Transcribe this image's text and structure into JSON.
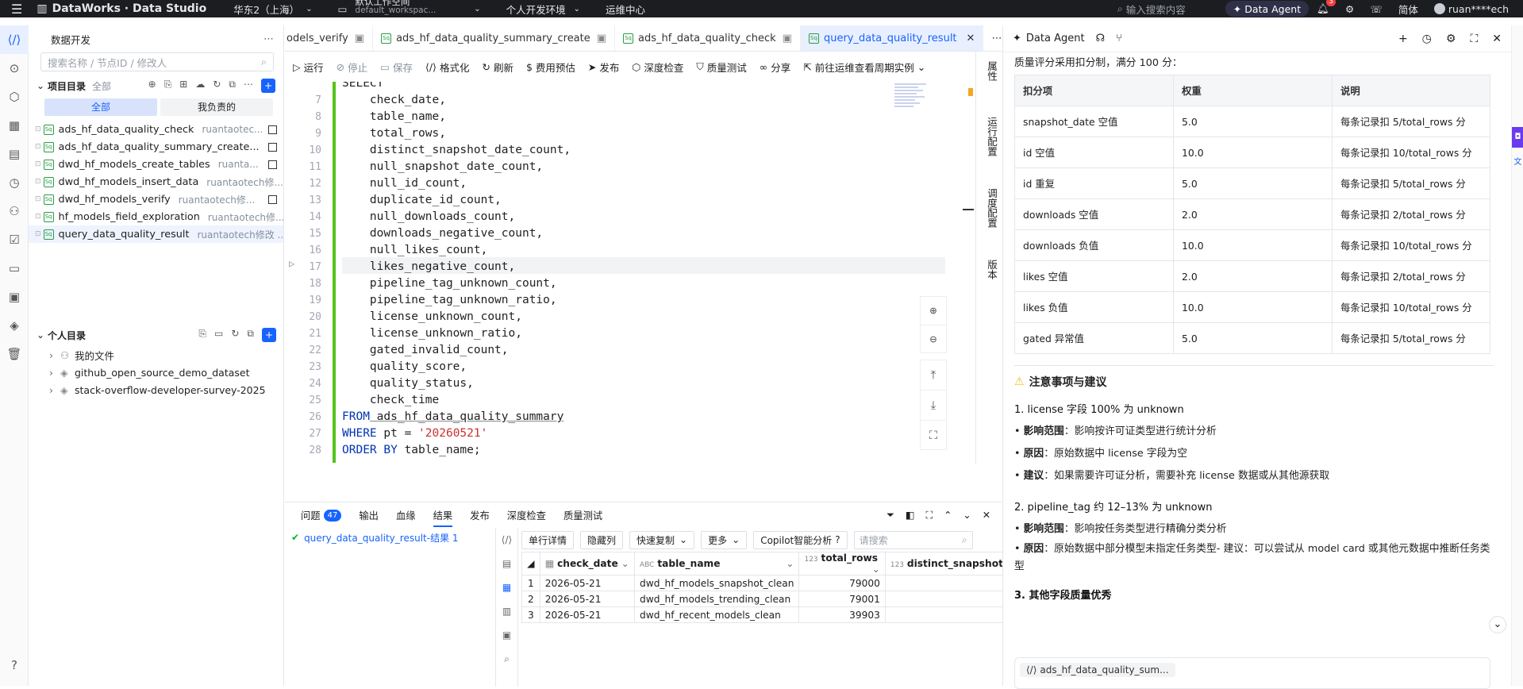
{
  "topbar": {
    "brand": "DataWorks · Data Studio",
    "region": "华东2（上海）",
    "workspace_title": "默认工作空间",
    "workspace_sub": "default_workspac...",
    "env": "个人开发环境",
    "ops": "运维中心",
    "search_placeholder": "输入搜索内容",
    "agent_button": "Data Agent",
    "notif_count": "3",
    "lang": "简体",
    "user": "ruan****ech"
  },
  "sidebar": {
    "title": "数据开发",
    "search_placeholder": "搜索名称 / 节点ID / 修改人",
    "project_dir": "项目目录",
    "project_scope": "全部",
    "filter_all": "全部",
    "filter_mine": "我负责的",
    "files": [
      {
        "name": "ads_hf_data_quality_check",
        "owner": "ruantaotec..."
      },
      {
        "name": "ads_hf_data_quality_summary_create...",
        "owner": ""
      },
      {
        "name": "dwd_hf_models_create_tables",
        "owner": "ruanta..."
      },
      {
        "name": "dwd_hf_models_insert_data",
        "owner": "ruantaotech修..."
      },
      {
        "name": "dwd_hf_models_verify",
        "owner": "ruantaotech修..."
      },
      {
        "name": "hf_models_field_exploration",
        "owner": "ruantaotech修..."
      },
      {
        "name": "query_data_quality_result",
        "owner": "ruantaotech修改 ..."
      }
    ],
    "personal_dir": "个人目录",
    "personal_items": [
      "我的文件",
      "github_open_source_demo_dataset",
      "stack-overflow-developer-survey-2025"
    ]
  },
  "tabs": [
    "odels_verify",
    "ads_hf_data_quality_summary_create",
    "ads_hf_data_quality_check",
    "query_data_quality_result"
  ],
  "toolbar": {
    "run": "运行",
    "stop": "停止",
    "save": "保存",
    "format": "格式化",
    "refresh": "刷新",
    "cost": "费用预估",
    "publish": "发布",
    "deep_check": "深度检查",
    "quality_test": "质量测试",
    "share": "分享",
    "goto_ops": "前往运维查看周期实例"
  },
  "code": {
    "first_line": "SELECT",
    "lines": [
      {
        "n": "7",
        "t": "    check_date,"
      },
      {
        "n": "8",
        "t": "    table_name,"
      },
      {
        "n": "9",
        "t": "    total_rows,"
      },
      {
        "n": "10",
        "t": "    distinct_snapshot_date_count,"
      },
      {
        "n": "11",
        "t": "    null_snapshot_date_count,"
      },
      {
        "n": "12",
        "t": "    null_id_count,"
      },
      {
        "n": "13",
        "t": "    duplicate_id_count,"
      },
      {
        "n": "14",
        "t": "    null_downloads_count,"
      },
      {
        "n": "15",
        "t": "    downloads_negative_count,"
      },
      {
        "n": "16",
        "t": "    null_likes_count,"
      },
      {
        "n": "17",
        "t": "    likes_negative_count,"
      },
      {
        "n": "18",
        "t": "    pipeline_tag_unknown_count,"
      },
      {
        "n": "19",
        "t": "    pipeline_tag_unknown_ratio,"
      },
      {
        "n": "20",
        "t": "    license_unknown_count,"
      },
      {
        "n": "21",
        "t": "    license_unknown_ratio,"
      },
      {
        "n": "22",
        "t": "    gated_invalid_count,"
      },
      {
        "n": "23",
        "t": "    quality_score,"
      },
      {
        "n": "24",
        "t": "    quality_status,"
      },
      {
        "n": "25",
        "t": "    check_time"
      }
    ],
    "l26": {
      "n": "26",
      "kw": "FROM",
      "rest": " ads_hf_data_quality_summary"
    },
    "l27": {
      "n": "27",
      "kw": "WHERE",
      "mid": " pt = ",
      "str": "'20260521'"
    },
    "l28": {
      "n": "28",
      "kw": "ORDER BY",
      "rest": " table_name;"
    }
  },
  "right_panel": [
    "属性",
    "运行配置",
    "调度配置",
    "版本"
  ],
  "bottom": {
    "tabs": [
      "问题",
      "输出",
      "血缘",
      "结果",
      "发布",
      "深度检查",
      "质量测试"
    ],
    "issues_count": "47",
    "result_item": "query_data_quality_result-结果 1",
    "grid_toolbar": [
      "单行详情",
      "隐藏列",
      "快速复制",
      "更多",
      "Copilot智能分析"
    ],
    "grid_search": "请搜索",
    "columns": [
      "check_date",
      "table_name",
      "total_rows",
      "distinct_snapshot_"
    ],
    "col_types": [
      "",
      "ABC",
      "123",
      "123"
    ],
    "rows": [
      [
        "1",
        "2026-05-21",
        "dwd_hf_models_snapshot_clean",
        "79000"
      ],
      [
        "2",
        "2026-05-21",
        "dwd_hf_models_trending_clean",
        "79001"
      ],
      [
        "3",
        "2026-05-21",
        "dwd_hf_recent_models_clean",
        "39903"
      ]
    ]
  },
  "agent": {
    "tab": "Data Agent",
    "intro": "质量评分采用扣分制，满分 100 分：",
    "table_headers": [
      "扣分项",
      "权重",
      "说明"
    ],
    "table_rows": [
      [
        "snapshot_date 空值",
        "5.0",
        "每条记录扣 5/total_rows 分"
      ],
      [
        "id 空值",
        "10.0",
        "每条记录扣 10/total_rows 分"
      ],
      [
        "id 重复",
        "5.0",
        "每条记录扣 5/total_rows 分"
      ],
      [
        "downloads 空值",
        "2.0",
        "每条记录扣 2/total_rows 分"
      ],
      [
        "downloads 负值",
        "10.0",
        "每条记录扣 10/total_rows 分"
      ],
      [
        "likes 空值",
        "2.0",
        "每条记录扣 2/total_rows 分"
      ],
      [
        "likes 负值",
        "10.0",
        "每条记录扣 10/total_rows 分"
      ],
      [
        "gated 异常值",
        "5.0",
        "每条记录扣 5/total_rows 分"
      ]
    ],
    "notes_title": "注意事项与建议",
    "s1_title": "1. license 字段 100% 为 unknown",
    "s1_b1_label": "影响范围",
    "s1_b1": "：影响按许可证类型进行统计分析",
    "s1_b2_label": "原因",
    "s1_b2": "：原始数据中 license 字段为空",
    "s1_b3_label": "建议",
    "s1_b3": "：如果需要许可证分析，需要补充 license 数据或从其他源获取",
    "s2_title": "2. pipeline_tag 约 12–13% 为 unknown",
    "s2_b1_label": "影响范围",
    "s2_b1": "：影响按任务类型进行精确分类分析",
    "s2_b2_label": "原因",
    "s2_b2": "：原始数据中部分模型未指定任务类型- 建议：可以尝试从 model card 或其他元数据中推断任务类型",
    "s3_title": "3. 其他字段质量优秀",
    "context_chip": "ads_hf_data_quality_sum..."
  }
}
